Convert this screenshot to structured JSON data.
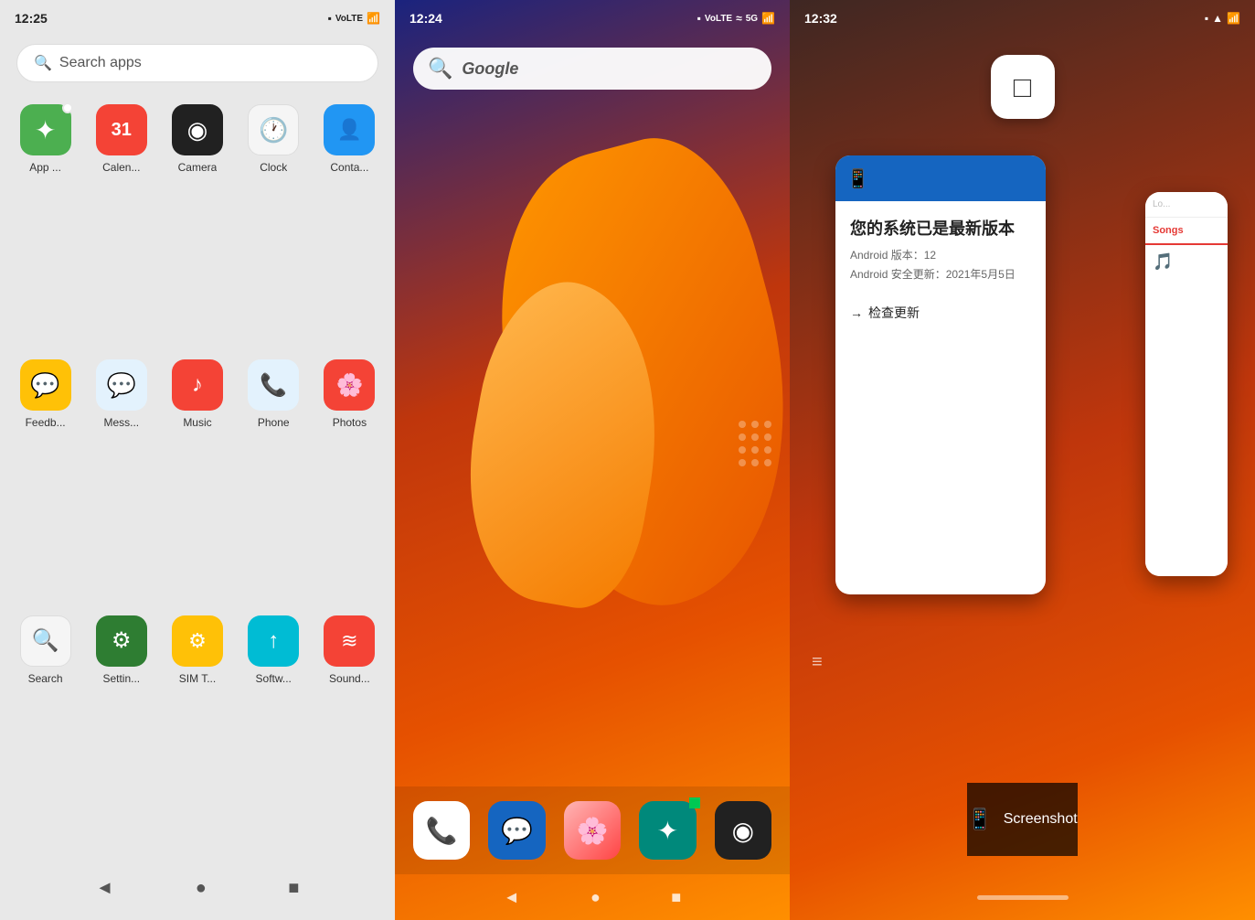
{
  "panel1": {
    "status": {
      "time": "12:25",
      "signal": "▲▼",
      "battery": "□",
      "volte": "VoLTE"
    },
    "search": {
      "placeholder": "Search apps",
      "icon": "🔍"
    },
    "apps": [
      {
        "id": "appstore",
        "label": "App ...",
        "icon": "✦",
        "color": "icon-appstore",
        "badge": true
      },
      {
        "id": "calendar",
        "label": "Calen...",
        "icon": "31",
        "color": "icon-calendar"
      },
      {
        "id": "camera",
        "label": "Camera",
        "icon": "◉",
        "color": "icon-camera"
      },
      {
        "id": "clock",
        "label": "Clock",
        "icon": "🕐",
        "color": "icon-clock"
      },
      {
        "id": "contacts",
        "label": "Conta...",
        "icon": "👤",
        "color": "icon-contacts"
      },
      {
        "id": "feedback",
        "label": "Feedb...",
        "icon": "💬",
        "color": "icon-feedback"
      },
      {
        "id": "messages",
        "label": "Mess...",
        "icon": "💬",
        "color": "icon-messages"
      },
      {
        "id": "music",
        "label": "Music",
        "icon": "♪",
        "color": "icon-music"
      },
      {
        "id": "phone",
        "label": "Phone",
        "icon": "📞",
        "color": "icon-phone"
      },
      {
        "id": "photos",
        "label": "Photos",
        "icon": "⬡",
        "color": "icon-photos"
      },
      {
        "id": "search",
        "label": "Search",
        "icon": "🔍",
        "color": "icon-search"
      },
      {
        "id": "settings",
        "label": "Settin...",
        "icon": "⚙",
        "color": "icon-settings"
      },
      {
        "id": "simt",
        "label": "SIM T...",
        "icon": "⚙",
        "color": "icon-simt"
      },
      {
        "id": "software",
        "label": "Softw...",
        "icon": "↑",
        "color": "icon-software"
      },
      {
        "id": "sound",
        "label": "Sound...",
        "icon": "≋",
        "color": "icon-sound"
      }
    ],
    "nav": {
      "back": "◄",
      "home": "●",
      "recent": "■"
    }
  },
  "panel2": {
    "status": {
      "time": "12:24",
      "battery": "□",
      "volte": "VoLTE",
      "signal5g": "5G",
      "wifi": "▲"
    },
    "google_search": {
      "icon": "🔍",
      "text": "Google"
    },
    "dock": [
      {
        "id": "phone",
        "icon": "📞",
        "color": "dock-phone"
      },
      {
        "id": "messages",
        "icon": "💬",
        "color": "dock-messages"
      },
      {
        "id": "photos",
        "icon": "⬡",
        "color": "dock-photos"
      },
      {
        "id": "appstore",
        "icon": "✦",
        "color": "dock-appstore",
        "badge": true
      },
      {
        "id": "camera",
        "icon": "◉",
        "color": "dock-camera"
      }
    ],
    "nav": {
      "back": "◄",
      "home": "●",
      "recent": "■"
    }
  },
  "panel3": {
    "status": {
      "time": "12:32",
      "battery": "□",
      "wifi": "▲",
      "signal": "▲"
    },
    "recent_app_icon": "□",
    "update_card": {
      "title": "您的系统已是最新版本",
      "android_version_label": "Android 版本：12",
      "security_update_label": "Android 安全更新：2021年5月5日",
      "check_update": "检查更新",
      "header_icon": "📱"
    },
    "right_card": {
      "search_text": "Lo...",
      "tab_text": "Songs",
      "icon": "🎵"
    },
    "screenshot": {
      "icon": "📱",
      "label": "Screenshot"
    },
    "list_icon": "≡"
  }
}
